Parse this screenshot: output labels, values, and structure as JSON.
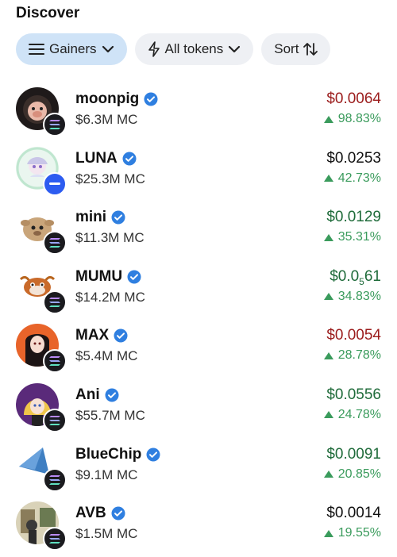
{
  "header": {
    "title": "Discover"
  },
  "filters": [
    {
      "label": "Gainers",
      "icon": "hamburger-icon",
      "trailing_icon": "chevron-down-icon",
      "active": true
    },
    {
      "label": "All tokens",
      "icon": "lightning-icon",
      "trailing_icon": "chevron-down-icon",
      "active": false
    },
    {
      "label": "Sort",
      "icon": "sort-arrows-icon",
      "active": false
    }
  ],
  "tokens": [
    {
      "name": "moonpig",
      "mc": "$6.3M MC",
      "price": "$0.0064",
      "price_color": "red",
      "change": "98.83%",
      "chain": "solana"
    },
    {
      "name": "LUNA",
      "mc": "$25.3M MC",
      "price": "$0.0253",
      "price_color": "black",
      "change": "42.73%",
      "chain": "blue-minus"
    },
    {
      "name": "mini",
      "mc": "$11.3M MC",
      "price": "$0.0129",
      "price_color": "green",
      "change": "35.31%",
      "chain": "solana"
    },
    {
      "name": "MUMU",
      "mc": "$14.2M MC",
      "price_main": "$0.0",
      "price_sub": "5",
      "price_tail": "61",
      "price_color": "green",
      "change": "34.83%",
      "chain": "solana"
    },
    {
      "name": "MAX",
      "mc": "$5.4M MC",
      "price": "$0.0054",
      "price_color": "red",
      "change": "28.78%",
      "chain": "solana"
    },
    {
      "name": "Ani",
      "mc": "$55.7M MC",
      "price": "$0.0556",
      "price_color": "green",
      "change": "24.78%",
      "chain": "solana"
    },
    {
      "name": "BlueChip",
      "mc": "$9.1M MC",
      "price": "$0.0091",
      "price_color": "green",
      "change": "20.85%",
      "chain": "solana"
    },
    {
      "name": "AVB",
      "mc": "$1.5M MC",
      "price": "$0.0014",
      "price_color": "black",
      "change": "19.55%",
      "chain": "solana"
    }
  ],
  "colors": {
    "red": "#9b1c1c",
    "green": "#1f6b3a",
    "up": "#3a9b5c",
    "verified": "#2f7fe0",
    "chip_active": "#cfe3f7",
    "chip": "#eef0f4"
  }
}
